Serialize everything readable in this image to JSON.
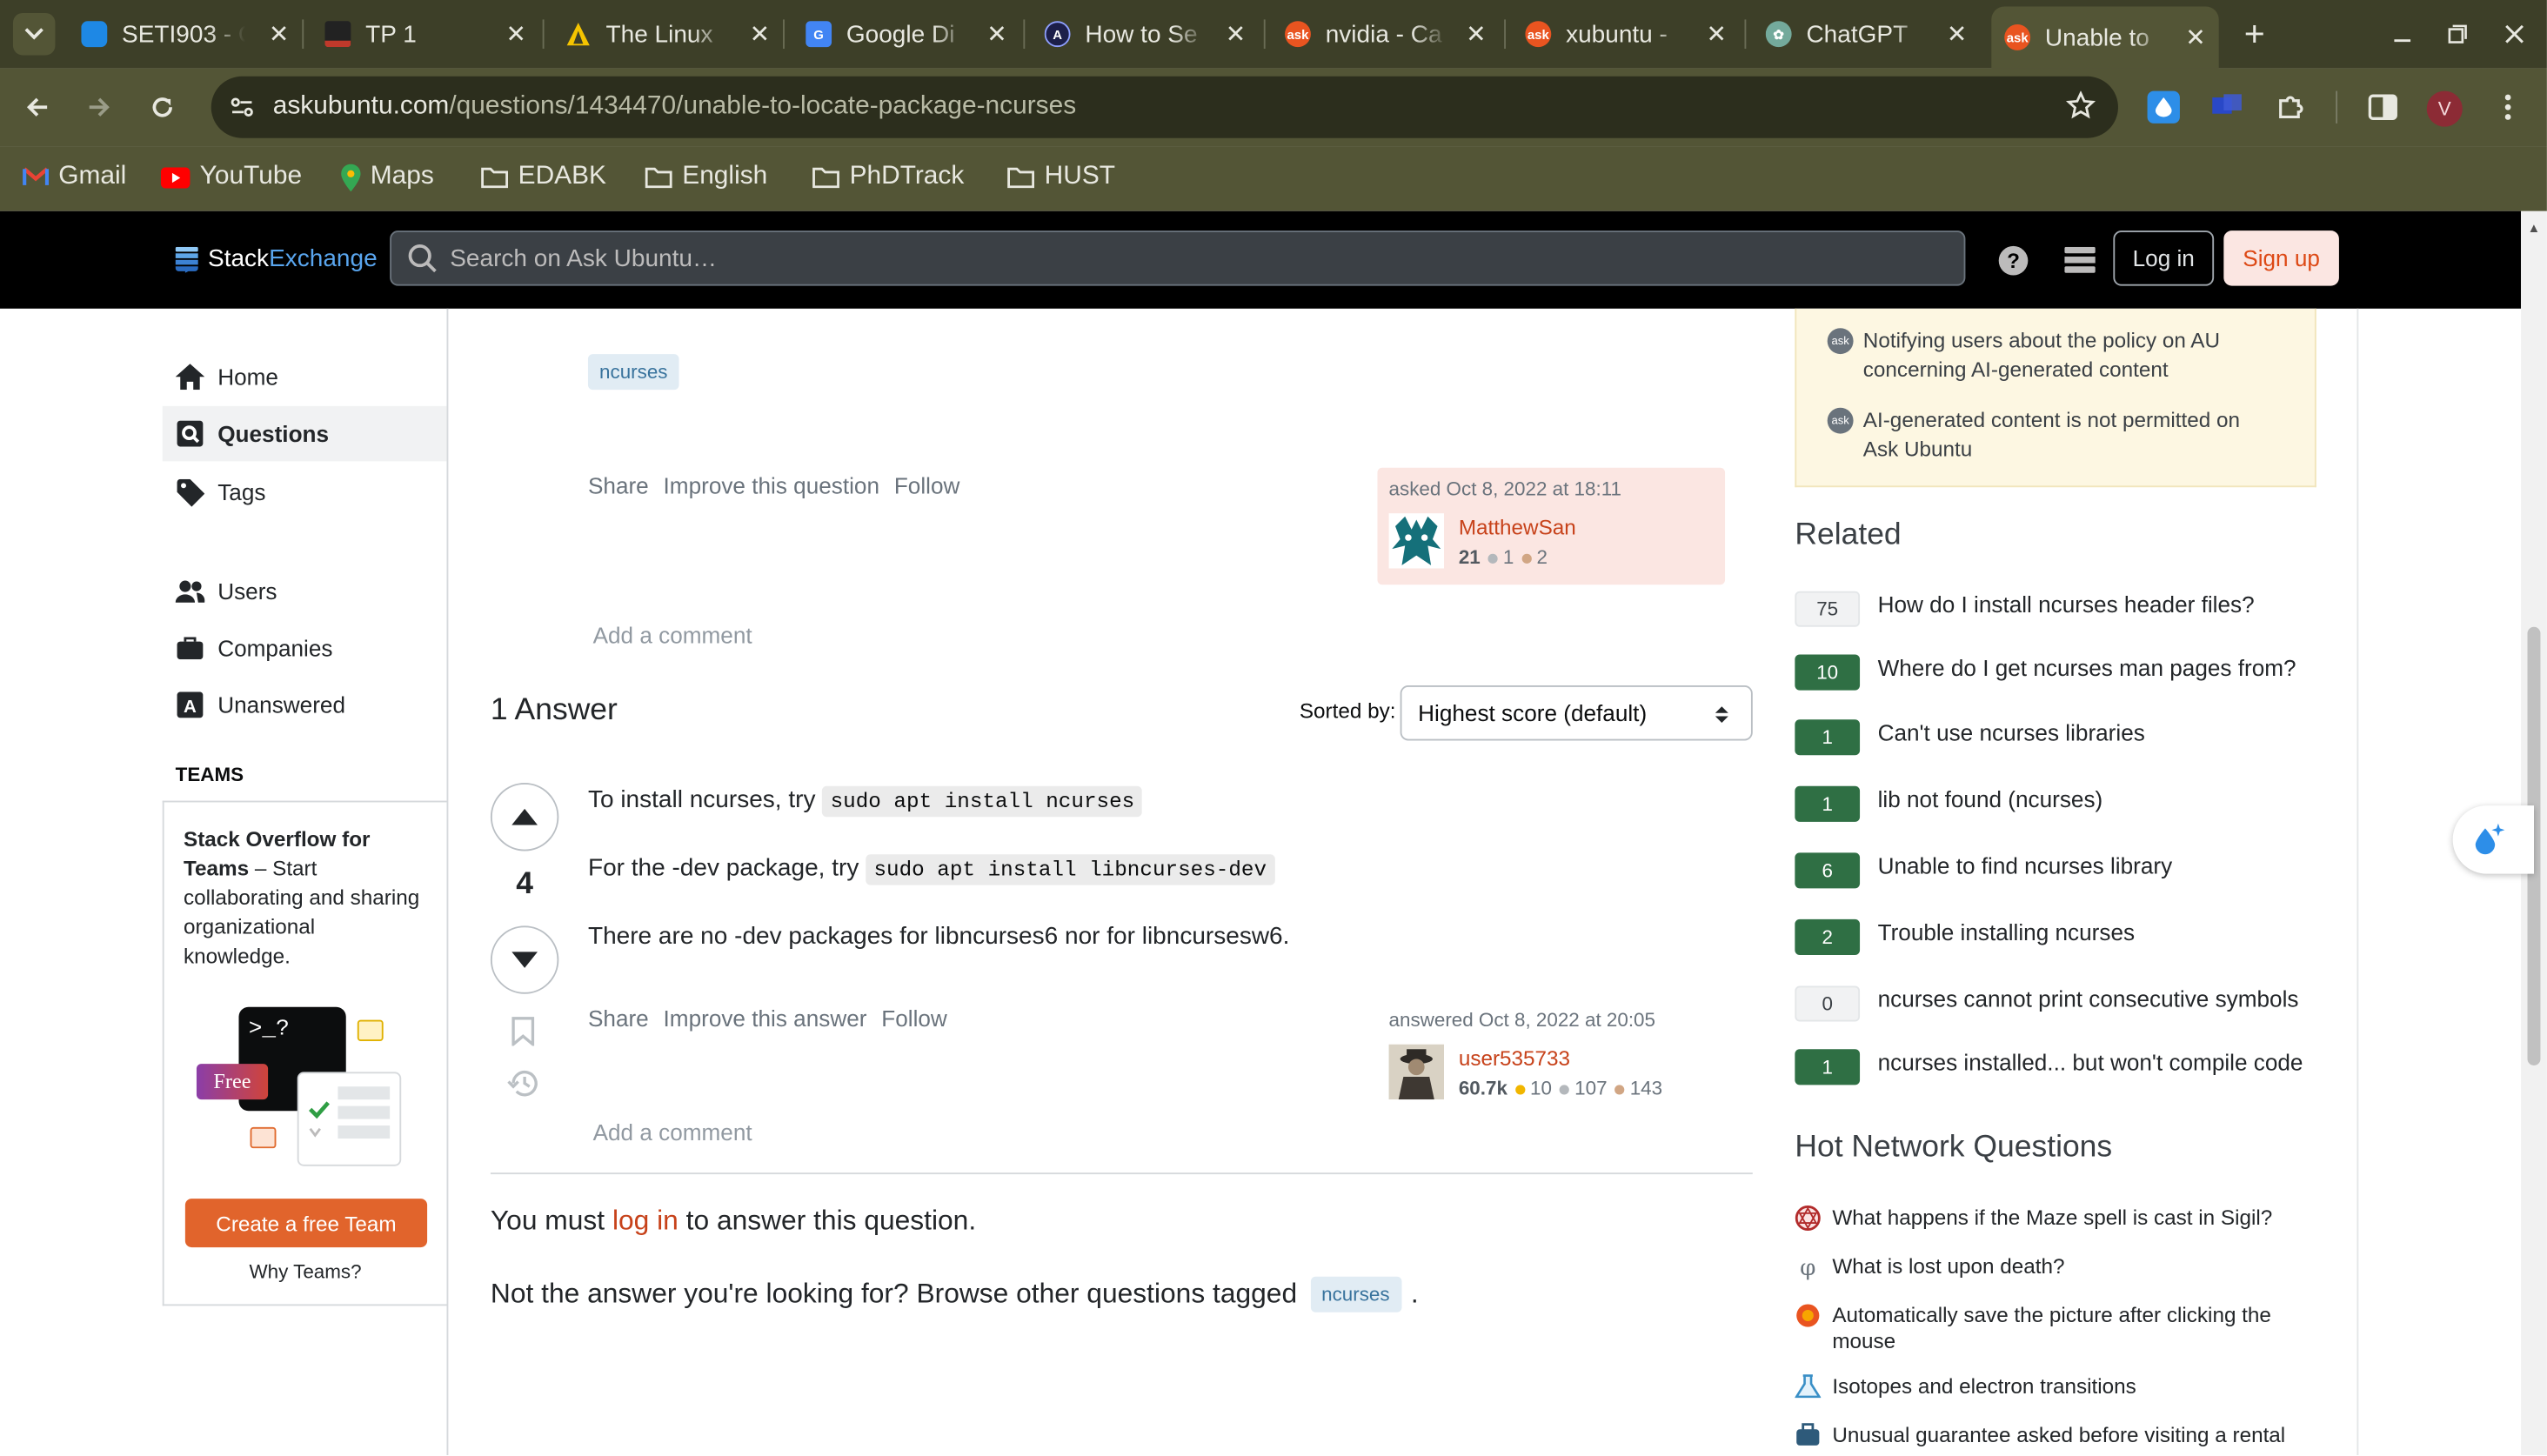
{
  "browser": {
    "tabs": [
      {
        "title": "SETI903 - C",
        "favicon": "onedrive-icon",
        "color": "#1e88e5"
      },
      {
        "title": "TP 1",
        "favicon": "tp-icon",
        "color": "#c0392b"
      },
      {
        "title": "The Linux",
        "favicon": "linux-icon",
        "color": "#f5c400"
      },
      {
        "title": "Google Di",
        "favicon": "google-docs-icon",
        "color": "#4285f4"
      },
      {
        "title": "How to Se",
        "favicon": "a-icon",
        "color": "#3b3f8c"
      },
      {
        "title": "nvidia - Ca",
        "favicon": "askubuntu-icon",
        "color": "#e95420"
      },
      {
        "title": "xubuntu -",
        "favicon": "askubuntu-icon",
        "color": "#e95420"
      },
      {
        "title": "ChatGPT",
        "favicon": "chatgpt-icon",
        "color": "#74aa9c"
      },
      {
        "title": "Unable to",
        "favicon": "askubuntu-icon",
        "color": "#e95420"
      }
    ],
    "url_host": "askubuntu.com",
    "url_path": "/questions/1434470/unable-to-locate-package-ncurses",
    "bookmarks": [
      "Gmail",
      "YouTube",
      "Maps",
      "EDABK",
      "English",
      "PhDTrack",
      "HUST"
    ],
    "profile_initial": "V"
  },
  "header": {
    "logo_stack": "Stack",
    "logo_exchange": "Exchange",
    "search_placeholder": "Search on Ask Ubuntu…",
    "login": "Log in",
    "signup": "Sign up"
  },
  "sidebar": {
    "items": [
      "Home",
      "Questions",
      "Tags",
      "Users",
      "Companies",
      "Unanswered"
    ],
    "teams_heading": "TEAMS",
    "teams_title": "Stack Overflow for Teams",
    "teams_text": " – Start collaborating and sharing organizational knowledge.",
    "free_badge": "Free",
    "terminal_text": ">_?",
    "create_team": "Create a free Team",
    "why_teams": "Why Teams?"
  },
  "question": {
    "tag": "ncurses",
    "share": "Share",
    "improve": "Improve this question",
    "follow": "Follow",
    "asked": "asked Oct 8, 2022 at 18:11",
    "user": "MatthewSan",
    "rep": "21",
    "silver": "1",
    "bronze": "2",
    "add_comment": "Add a comment"
  },
  "answers": {
    "count_label": "1 Answer",
    "sorted_by": "Sorted by:",
    "sort_value": "Highest score (default)"
  },
  "answer": {
    "score": "4",
    "line1_pre": "To install ncurses, try ",
    "line1_code": "sudo apt install ncurses",
    "line2_pre": "For the -dev package, try ",
    "line2_code": "sudo apt install libncurses-dev",
    "line3": "There are no -dev packages for libncurses6 nor for libncursesw6.",
    "share": "Share",
    "improve": "Improve this answer",
    "follow": "Follow",
    "answered": "answered Oct 8, 2022 at 20:05",
    "user": "user535733",
    "rep": "60.7k",
    "gold": "10",
    "silver": "107",
    "bronze": "143",
    "add_comment": "Add a comment"
  },
  "footer": {
    "must_pre": "You must ",
    "must_link": "log in",
    "must_post": " to answer this question.",
    "notanswer": "Not the answer you're looking for? Browse other questions tagged",
    "tag": "ncurses",
    "period": "."
  },
  "right": {
    "meta": [
      "Notifying users about the policy on AU concerning AI-generated content",
      "AI-generated content is not permitted on Ask Ubuntu"
    ],
    "related_title": "Related",
    "related": [
      {
        "score": "75",
        "title": "How do I install ncurses header files?",
        "accepted": false
      },
      {
        "score": "10",
        "title": "Where do I get ncurses man pages from?",
        "accepted": true
      },
      {
        "score": "1",
        "title": "Can't use ncurses libraries",
        "accepted": true
      },
      {
        "score": "1",
        "title": "lib not found (ncurses)",
        "accepted": true
      },
      {
        "score": "6",
        "title": "Unable to find ncurses library",
        "accepted": true
      },
      {
        "score": "2",
        "title": "Trouble installing ncurses",
        "accepted": true
      },
      {
        "score": "0",
        "title": "ncurses cannot print consecutive symbols",
        "accepted": false
      },
      {
        "score": "1",
        "title": "ncurses installed... but won't compile code",
        "accepted": true
      }
    ],
    "hnq_title": "Hot Network Questions",
    "hnq": [
      "What happens if the Maze spell is cast in Sigil?",
      "What is lost upon death?",
      "Automatically save the picture after clicking the mouse",
      "Isotopes and electron transitions",
      "Unusual guarantee asked before visiting a rental"
    ]
  },
  "colors": {
    "accent": "#dd4814",
    "link": "#c7421a",
    "accepted_green": "#2f6f44",
    "meta_bg": "#fdf7e2",
    "asked_bg": "#fbe6e2"
  }
}
